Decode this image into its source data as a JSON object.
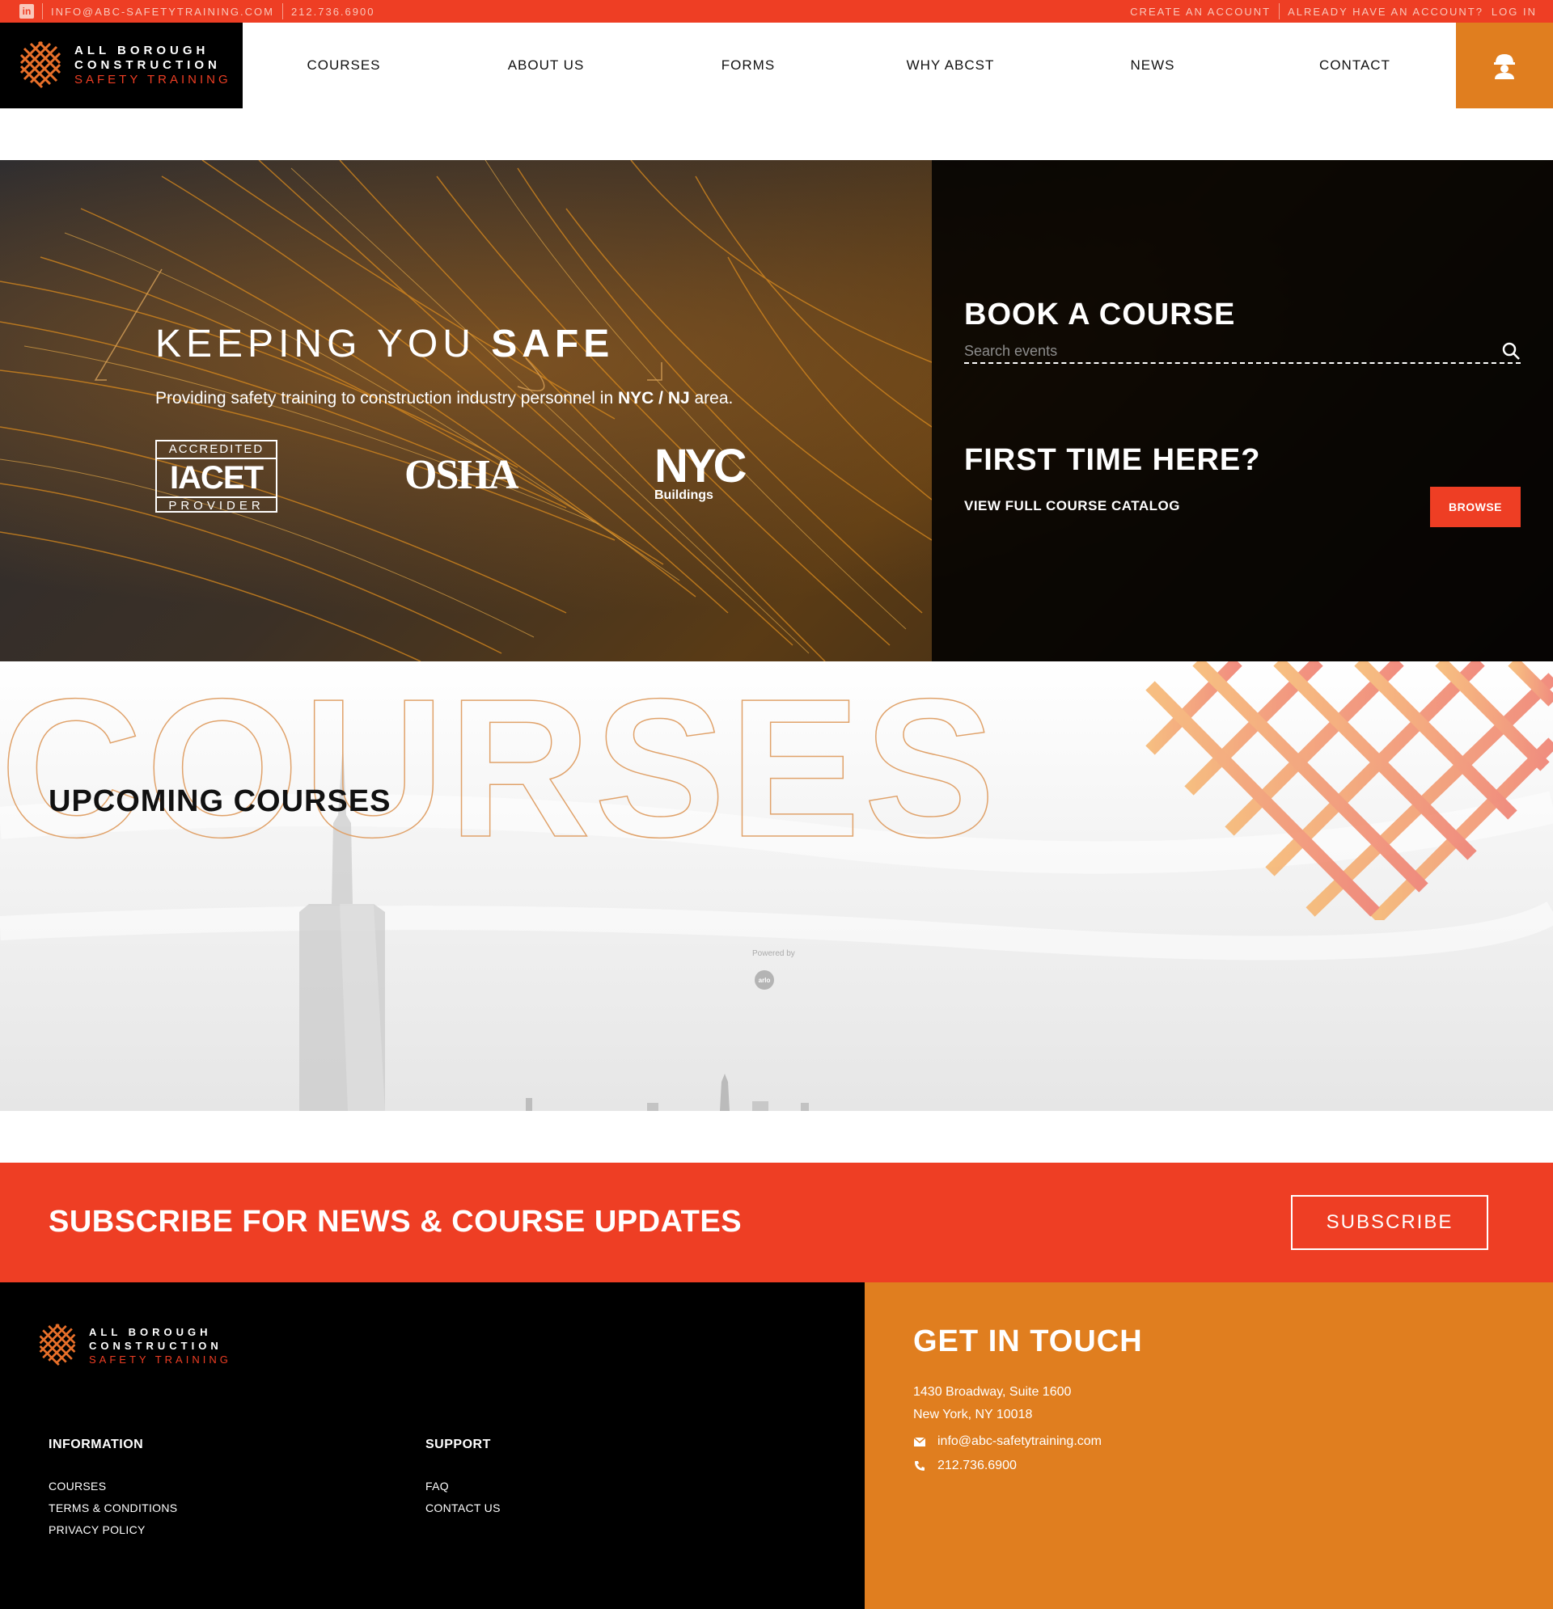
{
  "topbar": {
    "linkedin_icon": "linkedin-icon",
    "email": "INFO@ABC-SAFETYTRAINING.COM",
    "phone": "212.736.6900",
    "create_account": "CREATE AN ACCOUNT",
    "already_have": "ALREADY HAVE AN ACCOUNT?",
    "login": "LOG IN"
  },
  "brand": {
    "line1": "ALL BOROUGH",
    "line2": "CONSTRUCTION",
    "line3": "SAFETY TRAINING"
  },
  "nav": {
    "items": [
      "COURSES",
      "ABOUT US",
      "FORMS",
      "WHY ABCST",
      "NEWS",
      "CONTACT"
    ],
    "helmet_icon": "worker-helmet-icon"
  },
  "hero": {
    "title_light": "KEEPING YOU ",
    "title_bold": "SAFE",
    "subtitle_pre": "Providing safety training to construction industry personnel in ",
    "subtitle_bold": "NYC / NJ",
    "subtitle_post": " area.",
    "logos": {
      "iacet_top": "ACCREDITED",
      "iacet_mid": "IACET",
      "iacet_bottom": "PROVIDER",
      "osha": "OSHA",
      "nyc": "NYC",
      "nyc_sub": "Buildings"
    }
  },
  "book": {
    "title_light": "BOOK A ",
    "title_bold": "COURSE",
    "search_placeholder": "Search events",
    "first_light": "FIRST TIME ",
    "first_bold": "HERE?",
    "catalog": "VIEW FULL COURSE CATALOG",
    "browse": "BROWSE"
  },
  "courses": {
    "watermark": "COURSES",
    "heading_light": "UPCOMING ",
    "heading_bold": "COURSES",
    "powered_by": "Powered by",
    "powered_logo": "arlo"
  },
  "subscribe": {
    "bold": "SUBSCRIBE",
    "rest": " FOR NEWS & COURSE UPDATES",
    "button": "SUBSCRIBE"
  },
  "footer": {
    "info_heading": "INFORMATION",
    "info_links": [
      "COURSES",
      "TERMS & CONDITIONS",
      "PRIVACY POLICY"
    ],
    "support_heading": "SUPPORT",
    "support_links": [
      "FAQ",
      "CONTACT US"
    ],
    "touch_light": "GET ",
    "touch_bold": "IN TOUCH",
    "address_line1": "1430 Broadway, Suite 1600",
    "address_line2": "New York, NY 10018",
    "email": "info@abc-safetytraining.com",
    "phone": "212.736.6900"
  },
  "colors": {
    "red": "#ee3e24",
    "orange": "#e07e1f",
    "black": "#000000"
  }
}
